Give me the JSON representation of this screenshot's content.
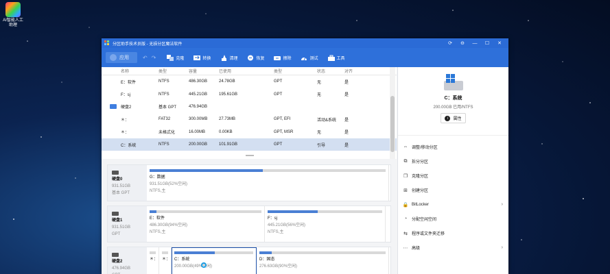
{
  "desktop": {
    "icon_label": "AI智能人工助理"
  },
  "window": {
    "title": "分区助手技术员版 - 无损分区魔法软件",
    "controls": [
      "⟳",
      "⊖",
      "—",
      "☐",
      "✕"
    ]
  },
  "toolbar": {
    "apply": "应用",
    "buttons": [
      "克隆",
      "转换",
      "清理",
      "恢复",
      "擦除",
      "测试",
      "工具"
    ]
  },
  "table": {
    "columns": [
      "名称",
      "类型",
      "容量",
      "已使用",
      "类型",
      "状态",
      "对齐"
    ],
    "rows": [
      {
        "kind": "part",
        "c": [
          "E：软件",
          "NTFS",
          "486.30GB",
          "24.78GB",
          "GPT",
          "无",
          "是"
        ]
      },
      {
        "kind": "part",
        "c": [
          "F：sj",
          "NTFS",
          "445.21GB",
          "195.61GB",
          "GPT",
          "无",
          "是"
        ]
      },
      {
        "kind": "disk",
        "c": [
          "硬盘2",
          "基本 GPT",
          "476.94GB",
          "",
          "",
          "",
          ""
        ]
      },
      {
        "kind": "part",
        "c": [
          "＊：",
          "FAT32",
          "300.00MB",
          "27.73MB",
          "GPT, EFI",
          "活动&系统",
          "是"
        ]
      },
      {
        "kind": "part",
        "c": [
          "＊：",
          "未格式化",
          "16.00MB",
          "0.00KB",
          "GPT, MSR",
          "无",
          "是"
        ]
      },
      {
        "kind": "part",
        "sel": true,
        "c": [
          "C：系统",
          "NTFS",
          "200.00GB",
          "101.91GB",
          "GPT",
          "引导",
          "是"
        ]
      }
    ]
  },
  "diskmap": [
    {
      "name": "硬盘0",
      "size": "931.51GB",
      "style": "基本 GPT",
      "parts": [
        {
          "label": "G：数据",
          "detail": "931.51GB(52%空闲)",
          "fs": "NTFS,主",
          "used_pct": 48
        }
      ]
    },
    {
      "name": "硬盘1",
      "size": "931.51GB",
      "style": "GPT",
      "parts": [
        {
          "label": "E：软件",
          "detail": "486.30GB(94%空闲)",
          "fs": "NTFS,主",
          "used_pct": 6
        },
        {
          "label": "F：sj",
          "detail": "445.21GB(56%空闲)",
          "fs": "NTFS,主",
          "used_pct": 44
        }
      ]
    },
    {
      "name": "硬盘2",
      "size": "476.94GB",
      "style": "GPT",
      "parts": [
        {
          "label": "＊：",
          "detail": "",
          "fs": "",
          "used_pct": 0
        },
        {
          "label": "＊：",
          "detail": "",
          "fs": "",
          "used_pct": 0
        },
        {
          "label": "C：系统",
          "detail": "200.00GB(49%空闲)",
          "fs": "",
          "used_pct": 51,
          "sel": true
        },
        {
          "label": "D：固态",
          "detail": "276.63GB(90%空闲)",
          "fs": "",
          "used_pct": 10
        }
      ]
    }
  ],
  "side": {
    "volume": "C：系统",
    "info": "200.00GB 已用/NTFS",
    "props": "属性",
    "ops": [
      {
        "icon": "⇔",
        "label": "调整/移动分区",
        "arrow": false
      },
      {
        "icon": "⧉",
        "label": "拆分分区",
        "arrow": false
      },
      {
        "icon": "❐",
        "label": "克隆分区",
        "arrow": false
      },
      {
        "icon": "⊞",
        "label": "创建分区",
        "arrow": false
      },
      {
        "icon": "🔒",
        "label": "BitLocker",
        "arrow": true
      },
      {
        "icon": "◔",
        "label": "分配空闲空间",
        "arrow": false
      },
      {
        "icon": "⇆",
        "label": "程序或文件夹迁移",
        "arrow": false
      },
      {
        "icon": "⋯",
        "label": "高级",
        "arrow": true
      }
    ]
  },
  "colors": {
    "titlebar": "#2b6bd6",
    "toolbar": "#2e70da",
    "accent": "#4a7fd4",
    "selection": "#d3dff1"
  }
}
